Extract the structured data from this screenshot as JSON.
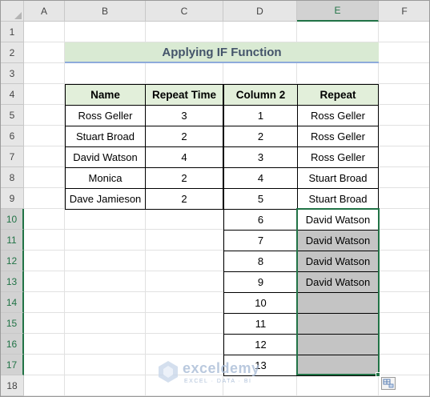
{
  "columns": [
    "A",
    "B",
    "C",
    "D",
    "E",
    "F"
  ],
  "rows": [
    "1",
    "2",
    "3",
    "4",
    "5",
    "6",
    "7",
    "8",
    "9",
    "10",
    "11",
    "12",
    "13",
    "14",
    "15",
    "16",
    "17",
    "18"
  ],
  "selected_column": "E",
  "selected_rows": [
    "10",
    "11",
    "12",
    "13",
    "14",
    "15",
    "16",
    "17"
  ],
  "title": "Applying IF Function",
  "table1": {
    "headers": [
      "Name",
      "Repeat Time"
    ],
    "rows": [
      [
        "Ross Geller",
        "3"
      ],
      [
        "Stuart Broad",
        "2"
      ],
      [
        "David Watson",
        "4"
      ],
      [
        "Monica",
        "2"
      ],
      [
        "Dave Jamieson",
        "2"
      ]
    ]
  },
  "table2": {
    "headers": [
      "Column 2",
      "Repeat"
    ],
    "rows": [
      [
        "1",
        "Ross Geller"
      ],
      [
        "2",
        "Ross Geller"
      ],
      [
        "3",
        "Ross Geller"
      ],
      [
        "4",
        "Stuart Broad"
      ],
      [
        "5",
        "Stuart Broad"
      ],
      [
        "6",
        "David Watson"
      ],
      [
        "7",
        "David Watson"
      ],
      [
        "8",
        "David Watson"
      ],
      [
        "9",
        "David Watson"
      ],
      [
        "10",
        ""
      ],
      [
        "11",
        ""
      ],
      [
        "12",
        ""
      ],
      [
        "13",
        ""
      ]
    ]
  },
  "watermark": {
    "name": "exceldemy",
    "tagline": "EXCEL · DATA · BI"
  },
  "colors": {
    "header_fill": "#e2efda",
    "title_fill": "#d9ead3",
    "selection": "#217346",
    "gray_fill": "#c4c4c4"
  }
}
